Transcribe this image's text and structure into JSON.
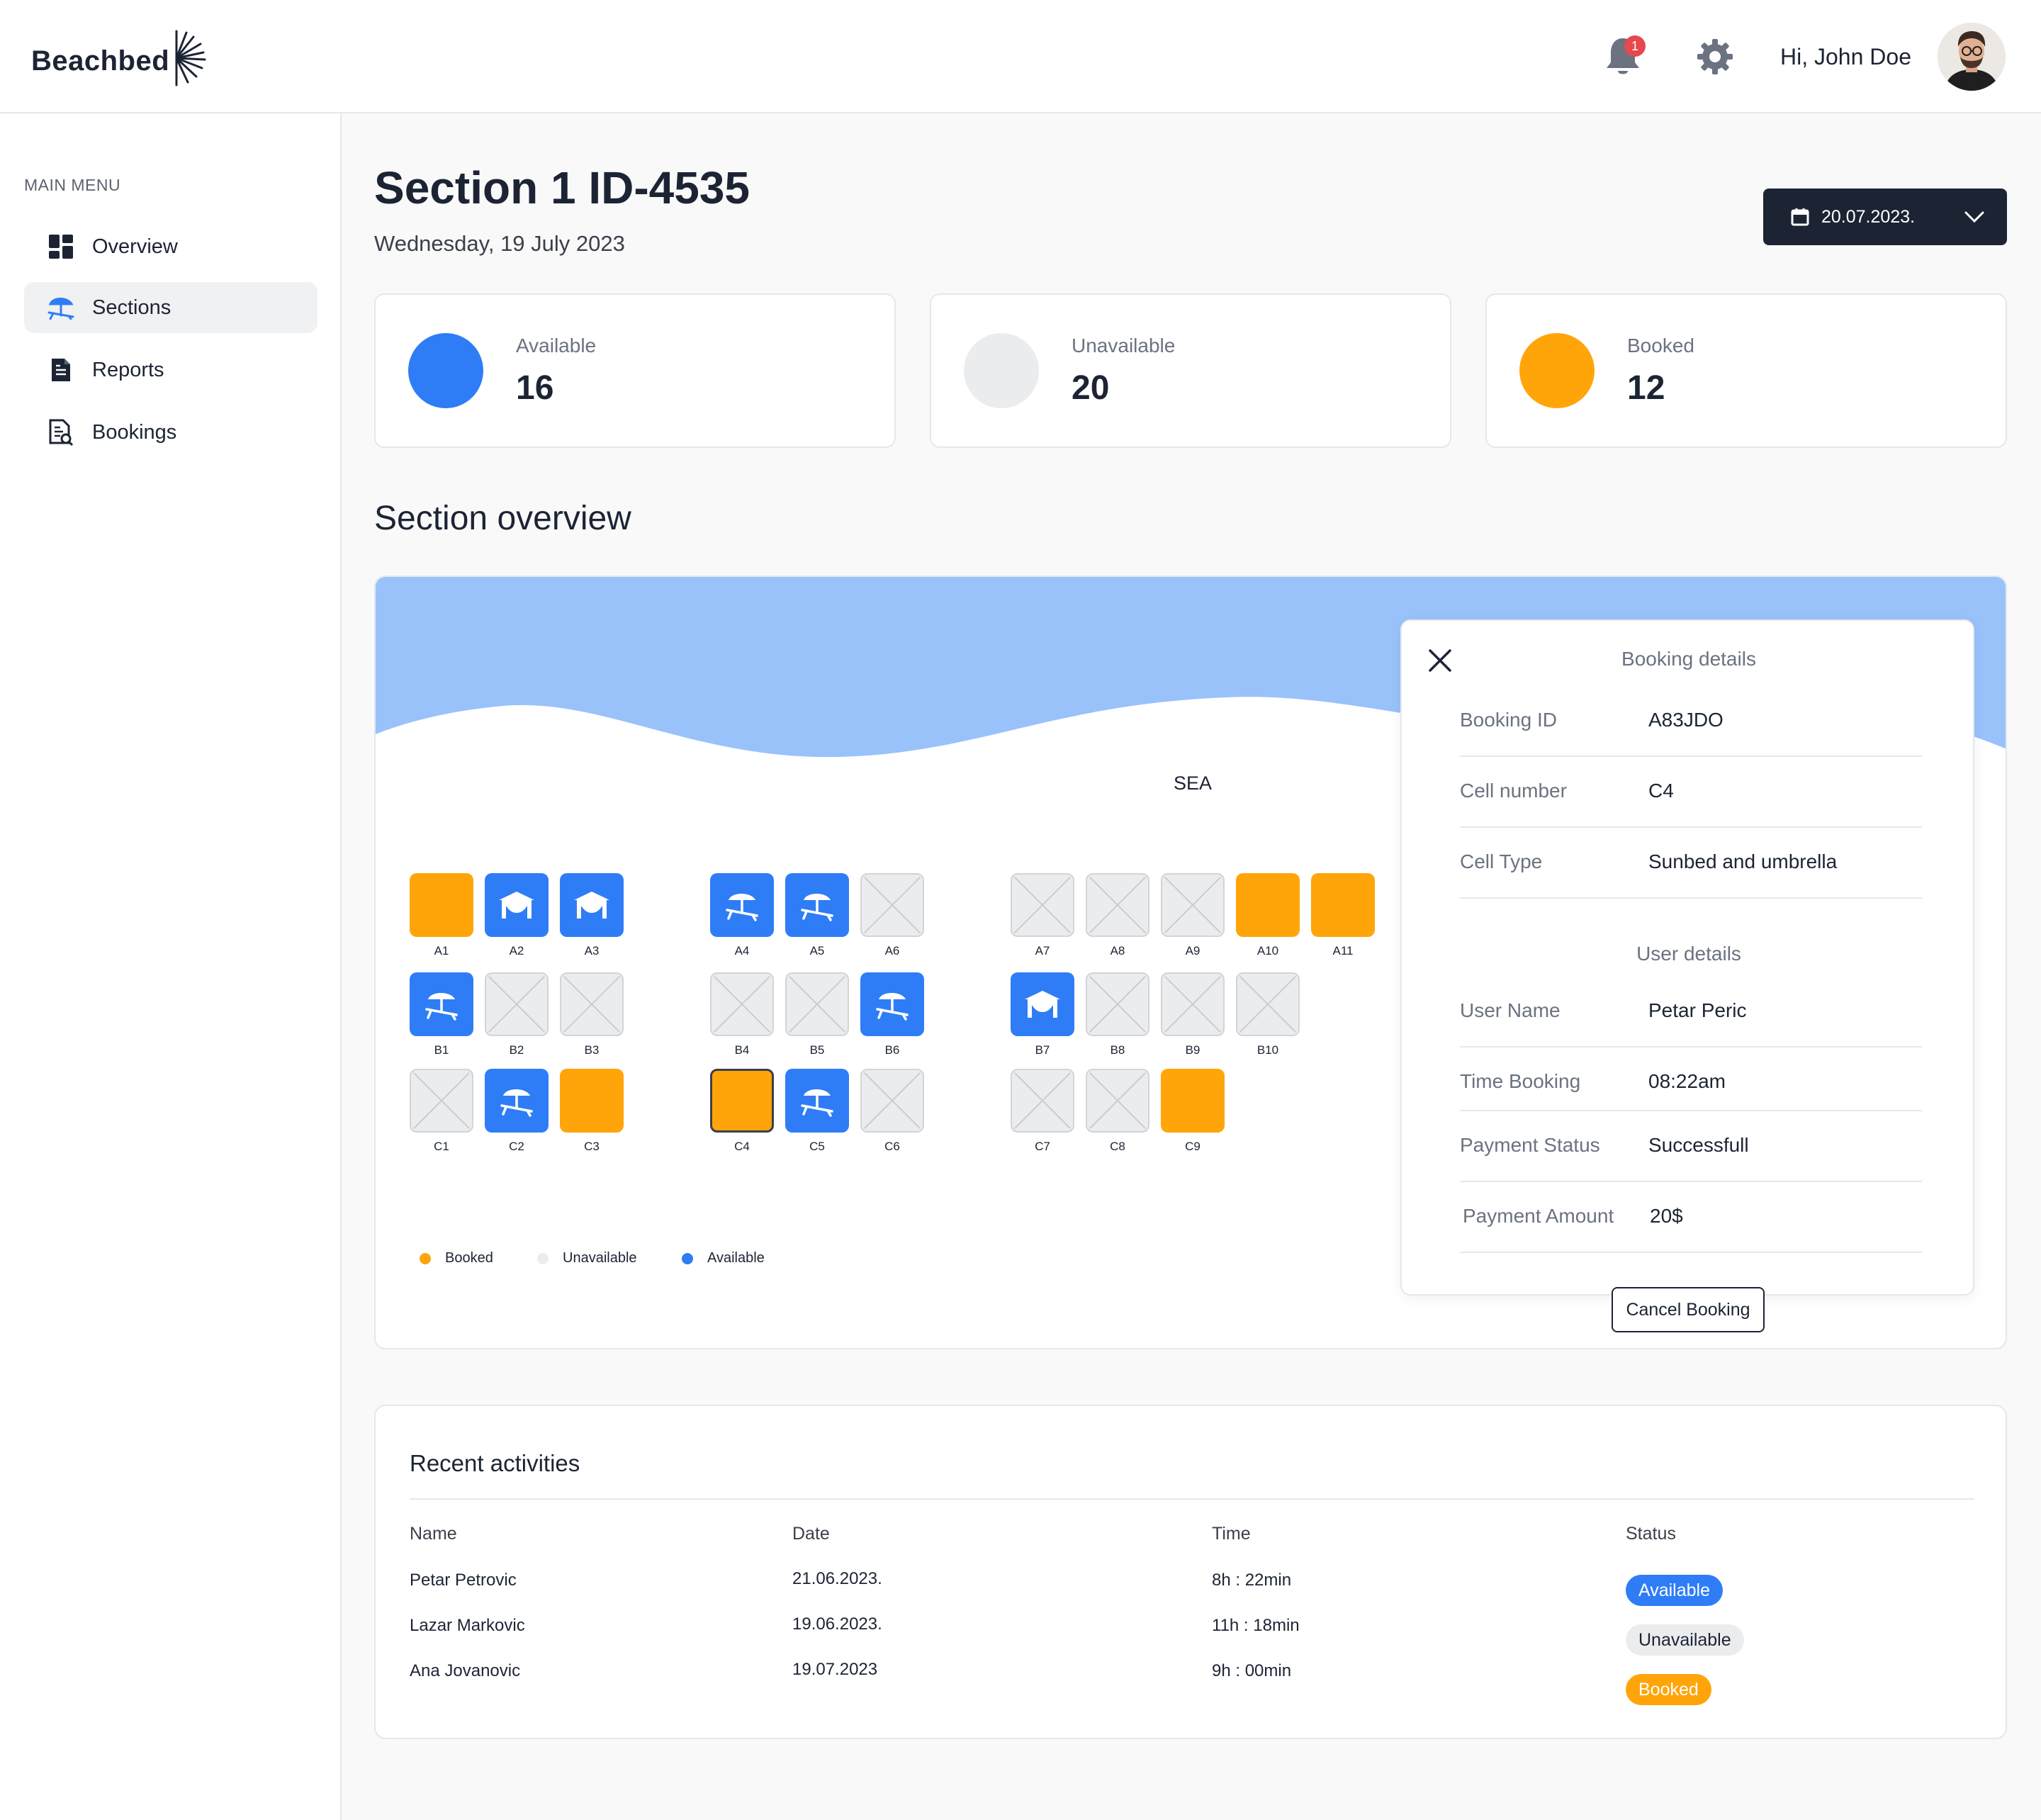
{
  "app": {
    "logo_text": "Beachbed"
  },
  "header": {
    "notification_count": "1",
    "greeting": "Hi, John Doe"
  },
  "sidebar": {
    "title": "MAIN MENU",
    "items": [
      {
        "label": "Overview",
        "icon": "dashboard-icon"
      },
      {
        "label": "Sections",
        "icon": "beach-umbrella-icon",
        "active": true
      },
      {
        "label": "Reports",
        "icon": "document-icon"
      },
      {
        "label": "Bookings",
        "icon": "bookings-icon"
      }
    ]
  },
  "page": {
    "title": "Section 1 ID-4535",
    "subtitle": "Wednesday, 19 July 2023",
    "date_picker": "20.07.2023."
  },
  "stats": [
    {
      "label": "Available",
      "value": "16",
      "color": "#2f7df6"
    },
    {
      "label": "Unavailable",
      "value": "20",
      "color": "#ebecee"
    },
    {
      "label": "Booked",
      "value": "12",
      "color": "#ffa50a"
    }
  ],
  "overview": {
    "heading": "Section overview",
    "sea_label": "SEA",
    "cells": [
      {
        "id": "A1",
        "status": "booked"
      },
      {
        "id": "A2",
        "status": "available",
        "icon": "tent-icon"
      },
      {
        "id": "A3",
        "status": "available",
        "icon": "tent-icon"
      },
      {
        "id": "A4",
        "status": "available",
        "icon": "sunbed-umbrella-icon"
      },
      {
        "id": "A5",
        "status": "available",
        "icon": "sunbed-umbrella-icon"
      },
      {
        "id": "A6",
        "status": "unavailable"
      },
      {
        "id": "A7",
        "status": "unavailable"
      },
      {
        "id": "A8",
        "status": "unavailable"
      },
      {
        "id": "A9",
        "status": "unavailable"
      },
      {
        "id": "A10",
        "status": "booked"
      },
      {
        "id": "A11",
        "status": "booked"
      },
      {
        "id": "B1",
        "status": "available",
        "icon": "sunbed-umbrella-icon"
      },
      {
        "id": "B2",
        "status": "unavailable"
      },
      {
        "id": "B3",
        "status": "unavailable"
      },
      {
        "id": "B4",
        "status": "unavailable"
      },
      {
        "id": "B5",
        "status": "unavailable"
      },
      {
        "id": "B6",
        "status": "available",
        "icon": "sunbed-umbrella-icon"
      },
      {
        "id": "B7",
        "status": "available",
        "icon": "tent-icon"
      },
      {
        "id": "B8",
        "status": "unavailable"
      },
      {
        "id": "B9",
        "status": "unavailable"
      },
      {
        "id": "B10",
        "status": "unavailable"
      },
      {
        "id": "C1",
        "status": "unavailable"
      },
      {
        "id": "C2",
        "status": "available",
        "icon": "sunbed-umbrella-icon"
      },
      {
        "id": "C3",
        "status": "booked"
      },
      {
        "id": "C4",
        "status": "booked",
        "selected": true
      },
      {
        "id": "C5",
        "status": "available",
        "icon": "sunbed-umbrella-icon"
      },
      {
        "id": "C6",
        "status": "unavailable"
      },
      {
        "id": "C7",
        "status": "unavailable"
      },
      {
        "id": "C8",
        "status": "unavailable"
      },
      {
        "id": "C9",
        "status": "booked"
      }
    ],
    "legend": [
      {
        "label": "Booked",
        "color": "#ffa50a"
      },
      {
        "label": "Unavailable",
        "color": "#ebecee"
      },
      {
        "label": "Available",
        "color": "#2f7df6"
      }
    ]
  },
  "booking_details": {
    "heading": "Booking details",
    "fields": [
      {
        "key": "Booking ID",
        "value": "A83JDO"
      },
      {
        "key": "Cell number",
        "value": "C4"
      },
      {
        "key": "Cell Type",
        "value": "Sunbed and umbrella"
      }
    ],
    "user_heading": "User details",
    "user_fields": [
      {
        "key": "User Name",
        "value": "Petar Peric"
      },
      {
        "key": "Time Booking",
        "value": "08:22am"
      },
      {
        "key": "Payment Status",
        "value": "Successfull"
      },
      {
        "key": "Payment Amount",
        "value": "20$"
      }
    ],
    "cancel_label": "Cancel Booking"
  },
  "activities": {
    "title": "Recent activities",
    "columns": [
      "Name",
      "Date",
      "Time",
      "Status"
    ],
    "rows": [
      {
        "name": "Petar Petrovic",
        "date": "21.06.2023.",
        "time": "8h : 22min",
        "status": "Available"
      },
      {
        "name": "Lazar Markovic",
        "date": "19.06.2023.",
        "time": "11h : 18min",
        "status": "Unavailable"
      },
      {
        "name": "Ana Jovanovic",
        "date": "19.07.2023",
        "time": "9h : 00min",
        "status": "Booked"
      }
    ]
  }
}
